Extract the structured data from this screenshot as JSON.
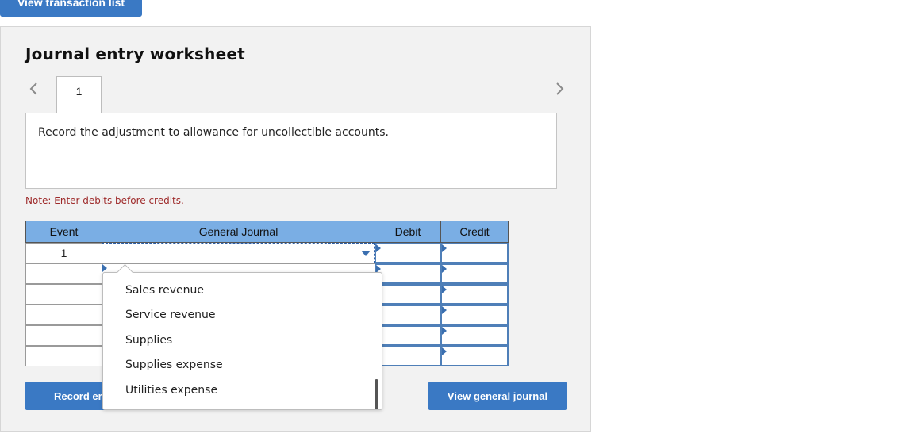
{
  "top_button": "View transaction list",
  "title": "Journal entry worksheet",
  "tabs": [
    {
      "label": "1"
    }
  ],
  "instruction": "Record the adjustment to allowance for uncollectible accounts.",
  "note": "Note: Enter debits before credits.",
  "table": {
    "headers": {
      "event": "Event",
      "journal": "General Journal",
      "debit": "Debit",
      "credit": "Credit"
    },
    "rows": [
      {
        "event": "1"
      },
      {
        "event": ""
      },
      {
        "event": ""
      },
      {
        "event": ""
      },
      {
        "event": ""
      },
      {
        "event": ""
      }
    ]
  },
  "dropdown": {
    "options": [
      "Sales revenue",
      "Service revenue",
      "Supplies",
      "Supplies expense",
      "Utilities expense"
    ]
  },
  "buttons": {
    "record": "Record er",
    "view_journal": "View general journal"
  },
  "colors": {
    "accent": "#3a79c4",
    "header_bg": "#7aaee4",
    "note": "#9e2a2a"
  },
  "icons": {
    "prev": "chevron-left-icon",
    "next": "chevron-right-icon",
    "dropdown": "caret-down-icon"
  }
}
